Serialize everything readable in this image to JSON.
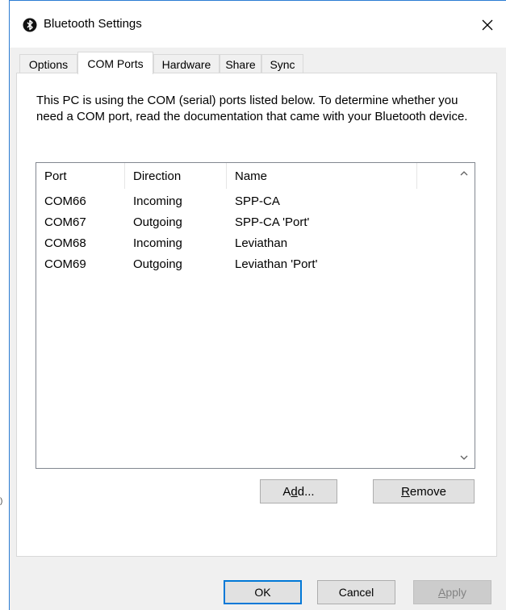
{
  "window": {
    "title": "Bluetooth Settings",
    "close_glyph": "✕",
    "icon": "bluetooth-icon",
    "accent_color": "#2b7cd3"
  },
  "stray_mark": ")",
  "tabs": [
    {
      "label": "Options",
      "active": false
    },
    {
      "label": "COM Ports",
      "active": true
    },
    {
      "label": "Hardware",
      "active": false
    },
    {
      "label": "Share",
      "active": false
    },
    {
      "label": "Sync",
      "active": false
    }
  ],
  "com_ports": {
    "description": "This PC is using the COM (serial) ports listed below. To determine whether you need a COM port, read the documentation that came with your Bluetooth device.",
    "columns": [
      "Port",
      "Direction",
      "Name"
    ],
    "rows": [
      {
        "port": "COM66",
        "direction": "Incoming",
        "name": "SPP-CA"
      },
      {
        "port": "COM67",
        "direction": "Outgoing",
        "name": "SPP-CA 'Port'"
      },
      {
        "port": "COM68",
        "direction": "Incoming",
        "name": "Leviathan"
      },
      {
        "port": "COM69",
        "direction": "Outgoing",
        "name": "Leviathan 'Port'"
      }
    ],
    "add_button": {
      "pre": "A",
      "accel": "d",
      "post": "d..."
    },
    "remove_button": {
      "pre": "",
      "accel": "R",
      "post": "emove"
    }
  },
  "dialog_buttons": {
    "ok": "OK",
    "cancel": "Cancel",
    "apply": {
      "pre": "",
      "accel": "A",
      "post": "pply",
      "disabled": true
    }
  }
}
